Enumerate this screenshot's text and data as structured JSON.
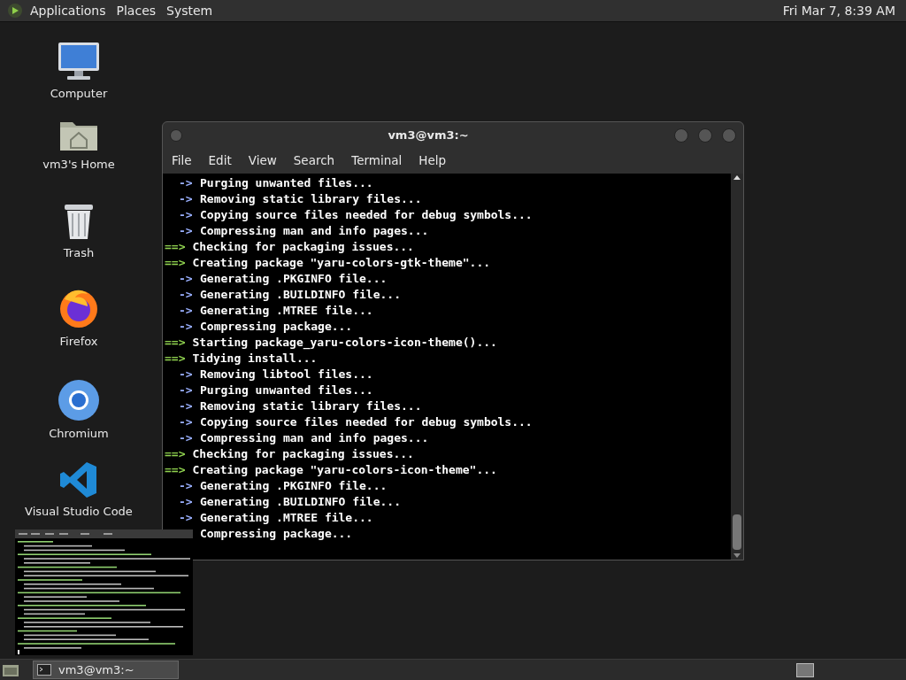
{
  "top_panel": {
    "menus": [
      "Applications",
      "Places",
      "System"
    ],
    "clock": "Fri Mar 7, 8:39 AM"
  },
  "desktop_icons": [
    {
      "kind": "computer",
      "label": "Computer"
    },
    {
      "kind": "home",
      "label": "vm3's Home"
    },
    {
      "kind": "trash",
      "label": "Trash"
    },
    {
      "kind": "firefox",
      "label": "Firefox"
    },
    {
      "kind": "chromium",
      "label": "Chromium"
    },
    {
      "kind": "vscode",
      "label": "Visual Studio Code"
    }
  ],
  "terminal": {
    "title": "vm3@vm3:~",
    "menu": [
      "File",
      "Edit",
      "View",
      "Search",
      "Terminal",
      "Help"
    ],
    "lines": [
      {
        "kind": "sub",
        "prefix": "->",
        "text": "Purging unwanted files..."
      },
      {
        "kind": "sub",
        "prefix": "->",
        "text": "Removing static library files..."
      },
      {
        "kind": "sub",
        "prefix": "->",
        "text": "Copying source files needed for debug symbols..."
      },
      {
        "kind": "sub",
        "prefix": "->",
        "text": "Compressing man and info pages..."
      },
      {
        "kind": "main",
        "prefix": "==>",
        "text": "Checking for packaging issues..."
      },
      {
        "kind": "main",
        "prefix": "==>",
        "text": "Creating package \"yaru-colors-gtk-theme\"..."
      },
      {
        "kind": "sub",
        "prefix": "->",
        "text": "Generating .PKGINFO file..."
      },
      {
        "kind": "sub",
        "prefix": "->",
        "text": "Generating .BUILDINFO file..."
      },
      {
        "kind": "sub",
        "prefix": "->",
        "text": "Generating .MTREE file..."
      },
      {
        "kind": "sub",
        "prefix": "->",
        "text": "Compressing package..."
      },
      {
        "kind": "main",
        "prefix": "==>",
        "text": "Starting package_yaru-colors-icon-theme()..."
      },
      {
        "kind": "main",
        "prefix": "==>",
        "text": "Tidying install..."
      },
      {
        "kind": "sub",
        "prefix": "->",
        "text": "Removing libtool files..."
      },
      {
        "kind": "sub",
        "prefix": "->",
        "text": "Purging unwanted files..."
      },
      {
        "kind": "sub",
        "prefix": "->",
        "text": "Removing static library files..."
      },
      {
        "kind": "sub",
        "prefix": "->",
        "text": "Copying source files needed for debug symbols..."
      },
      {
        "kind": "sub",
        "prefix": "->",
        "text": "Compressing man and info pages..."
      },
      {
        "kind": "main",
        "prefix": "==>",
        "text": "Checking for packaging issues..."
      },
      {
        "kind": "main",
        "prefix": "==>",
        "text": "Creating package \"yaru-colors-icon-theme\"..."
      },
      {
        "kind": "sub",
        "prefix": "->",
        "text": "Generating .PKGINFO file..."
      },
      {
        "kind": "sub",
        "prefix": "->",
        "text": "Generating .BUILDINFO file..."
      },
      {
        "kind": "sub",
        "prefix": "->",
        "text": "Generating .MTREE file..."
      },
      {
        "kind": "sub",
        "text": "Compressing package..."
      }
    ]
  },
  "taskbar": {
    "windows": [
      {
        "title": "vm3@vm3:~",
        "selected": true
      }
    ]
  }
}
